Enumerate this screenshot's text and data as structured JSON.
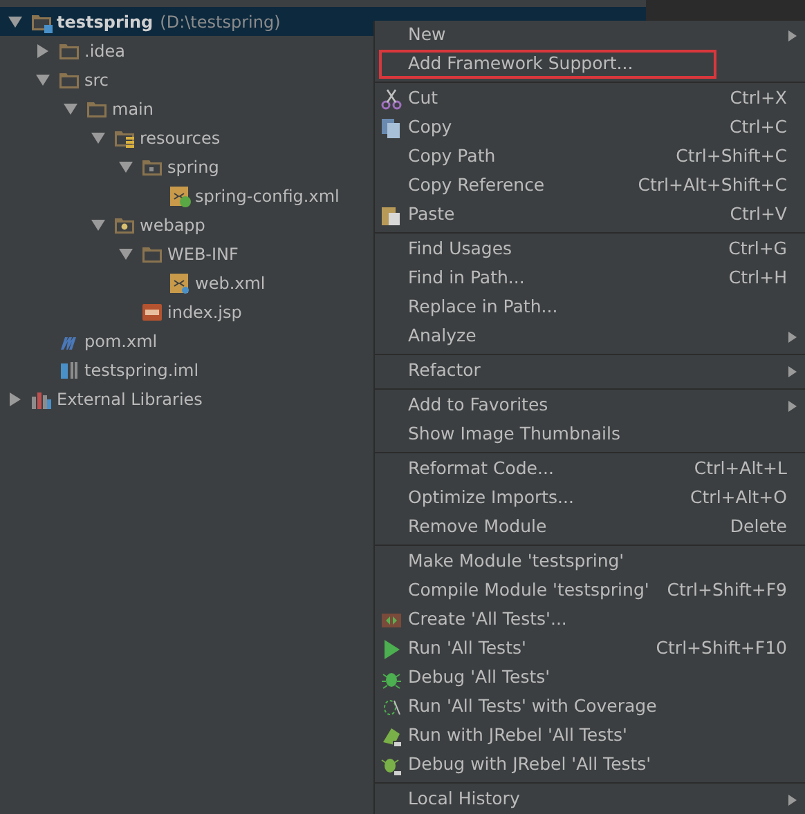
{
  "project_tree": [
    {
      "name": "testspring",
      "path": "(D:\\testspring)",
      "kind": "module",
      "expanded": true,
      "selected": true,
      "children": [
        {
          "name": ".idea",
          "kind": "folder",
          "expanded": false,
          "selected": false
        },
        {
          "name": "src",
          "kind": "folder",
          "expanded": true,
          "selected": false,
          "children": [
            {
              "name": "main",
              "kind": "folder",
              "expanded": true,
              "selected": false,
              "children": [
                {
                  "name": "resources",
                  "kind": "resources",
                  "expanded": true,
                  "selected": false,
                  "children": [
                    {
                      "name": "spring",
                      "kind": "package",
                      "expanded": true,
                      "selected": false,
                      "children": [
                        {
                          "name": "spring-config.xml",
                          "kind": "spring-xml",
                          "selected": false
                        }
                      ]
                    }
                  ]
                },
                {
                  "name": "webapp",
                  "kind": "web",
                  "expanded": true,
                  "selected": false,
                  "children": [
                    {
                      "name": "WEB-INF",
                      "kind": "folder",
                      "expanded": true,
                      "selected": false,
                      "children": [
                        {
                          "name": "web.xml",
                          "kind": "xml",
                          "selected": false
                        }
                      ]
                    },
                    {
                      "name": "index.jsp",
                      "kind": "jsp",
                      "selected": false
                    }
                  ]
                }
              ]
            }
          ]
        },
        {
          "name": "pom.xml",
          "kind": "maven",
          "selected": false
        },
        {
          "name": "testspring.iml",
          "kind": "iml",
          "selected": false
        }
      ]
    },
    {
      "name": "External Libraries",
      "kind": "libraries",
      "expanded": false,
      "selected": false
    }
  ],
  "context_menu": [
    [
      {
        "label": "New",
        "submenu": true
      },
      {
        "label": "Add Framework Support...",
        "outlined": true
      }
    ],
    [
      {
        "label": "Cut",
        "shortcut": "Ctrl+X",
        "kind": "scissors"
      },
      {
        "label": "Copy",
        "shortcut": "Ctrl+C",
        "kind": "copy"
      },
      {
        "label": "Copy Path",
        "shortcut": "Ctrl+Shift+C"
      },
      {
        "label": "Copy Reference",
        "shortcut": "Ctrl+Alt+Shift+C"
      },
      {
        "label": "Paste",
        "shortcut": "Ctrl+V",
        "kind": "paste"
      }
    ],
    [
      {
        "label": "Find Usages",
        "shortcut": "Ctrl+G"
      },
      {
        "label": "Find in Path...",
        "shortcut": "Ctrl+H"
      },
      {
        "label": "Replace in Path..."
      },
      {
        "label": "Analyze",
        "submenu": true
      }
    ],
    [
      {
        "label": "Refactor",
        "submenu": true
      }
    ],
    [
      {
        "label": "Add to Favorites",
        "submenu": true
      },
      {
        "label": "Show Image Thumbnails"
      }
    ],
    [
      {
        "label": "Reformat Code...",
        "shortcut": "Ctrl+Alt+L"
      },
      {
        "label": "Optimize Imports...",
        "shortcut": "Ctrl+Alt+O"
      },
      {
        "label": "Remove Module",
        "shortcut": "Delete"
      }
    ],
    [
      {
        "label": "Make Module 'testspring'"
      },
      {
        "label": "Compile Module 'testspring'",
        "shortcut": "Ctrl+Shift+F9"
      },
      {
        "label": "Create 'All Tests'...",
        "kind": "create-test"
      },
      {
        "label": "Run 'All Tests'",
        "shortcut": "Ctrl+Shift+F10",
        "kind": "run"
      },
      {
        "label": "Debug 'All Tests'",
        "kind": "debug"
      },
      {
        "label": "Run 'All Tests' with Coverage",
        "kind": "coverage"
      },
      {
        "label": "Run with JRebel 'All Tests'",
        "kind": "jrebel-run"
      },
      {
        "label": "Debug with JRebel 'All Tests'",
        "kind": "jrebel-debug"
      }
    ],
    [
      {
        "label": "Local History",
        "submenu": true
      }
    ]
  ]
}
